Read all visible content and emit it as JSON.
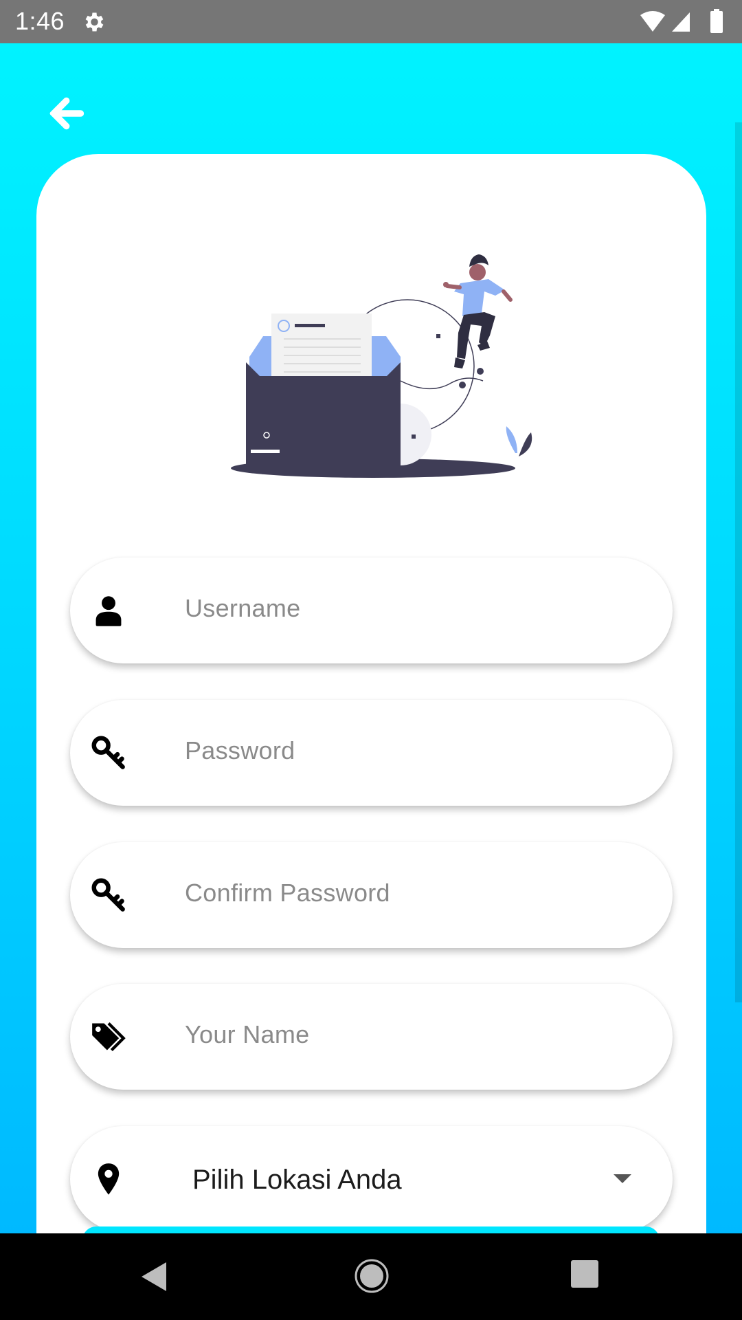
{
  "status_bar": {
    "time": "1:46",
    "icons": [
      "gear-icon",
      "wifi-icon",
      "signal-icon",
      "battery-icon"
    ]
  },
  "header": {
    "back_icon": "arrow-left-icon"
  },
  "form": {
    "fields": [
      {
        "placeholder": "Username",
        "icon": "user-icon"
      },
      {
        "placeholder": "Password",
        "icon": "key-icon"
      },
      {
        "placeholder": "Confirm Password",
        "icon": "key-icon"
      },
      {
        "placeholder": "Your Name",
        "icon": "tags-icon"
      }
    ],
    "location": {
      "value": "Pilih Lokasi Anda",
      "icon": "map-marker-icon",
      "dropdown_icon": "caret-down-icon"
    }
  },
  "nav_bar": {
    "icons": [
      "nav-back-icon",
      "nav-home-icon",
      "nav-recents-icon"
    ]
  },
  "colors": {
    "gradient_top": "#00f3ff",
    "gradient_bottom": "#00b9ff",
    "card": "#ffffff",
    "placeholder": "#8a8a8a",
    "illustration_dark": "#3f3d56",
    "illustration_accent": "#8fb2f5"
  }
}
